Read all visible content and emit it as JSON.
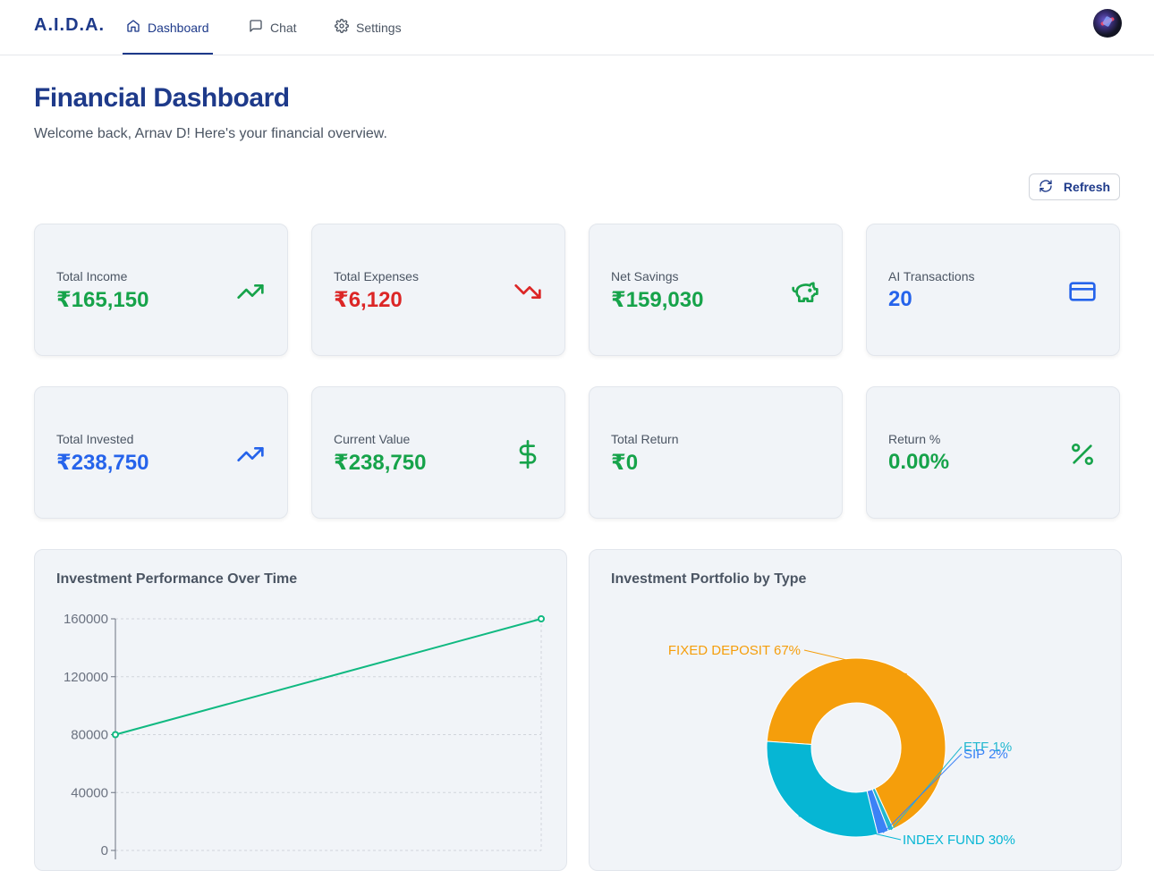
{
  "nav": {
    "brand": "A.I.D.A.",
    "tabs": [
      {
        "label": "Dashboard",
        "icon": "home-icon",
        "active": true
      },
      {
        "label": "Chat",
        "icon": "chat-icon",
        "active": false
      },
      {
        "label": "Settings",
        "icon": "gear-icon",
        "active": false
      }
    ]
  },
  "header": {
    "title": "Financial Dashboard",
    "subtitle": "Welcome back, Arnav D! Here's your financial overview.",
    "refresh_label": "Refresh"
  },
  "stats": [
    {
      "label": "Total Income",
      "value": "₹165,150",
      "color": "#16a34a",
      "icon": "trending-up-icon"
    },
    {
      "label": "Total Expenses",
      "value": "₹6,120",
      "color": "#dc2626",
      "icon": "trending-down-icon"
    },
    {
      "label": "Net Savings",
      "value": "₹159,030",
      "color": "#16a34a",
      "icon": "piggy-bank-icon"
    },
    {
      "label": "AI Transactions",
      "value": "20",
      "color": "#2563eb",
      "icon": "credit-card-icon"
    },
    {
      "label": "Total Invested",
      "value": "₹238,750",
      "color": "#2563eb",
      "icon": "trending-up-icon"
    },
    {
      "label": "Current Value",
      "value": "₹238,750",
      "color": "#16a34a",
      "icon": "dollar-icon"
    },
    {
      "label": "Total Return",
      "value": "₹0",
      "color": "#16a34a",
      "icon": ""
    },
    {
      "label": "Return %",
      "value": "0.00%",
      "color": "#16a34a",
      "icon": "percent-icon"
    }
  ],
  "panels": {
    "performance_title": "Investment Performance Over Time",
    "portfolio_title": "Investment Portfolio by Type"
  },
  "chart_data": [
    {
      "type": "line",
      "title": "Investment Performance Over Time",
      "y": [
        80000,
        160000
      ],
      "ylim": [
        0,
        160000
      ],
      "yticks": [
        0,
        40000,
        80000,
        120000,
        160000
      ],
      "grid": true,
      "color": "#10b981"
    },
    {
      "type": "pie",
      "title": "Investment Portfolio by Type",
      "donut": true,
      "slices": [
        {
          "label": "FIXED DEPOSIT",
          "pct": "67%",
          "value": 67,
          "color": "#f59e0b"
        },
        {
          "label": "ETF",
          "pct": "1%",
          "value": 1,
          "color": "#22b8cf"
        },
        {
          "label": "SIP",
          "pct": "2%",
          "value": 2,
          "color": "#3b82f6"
        },
        {
          "label": "INDEX FUND",
          "pct": "30%",
          "value": 30,
          "color": "#06b6d4"
        }
      ]
    }
  ]
}
